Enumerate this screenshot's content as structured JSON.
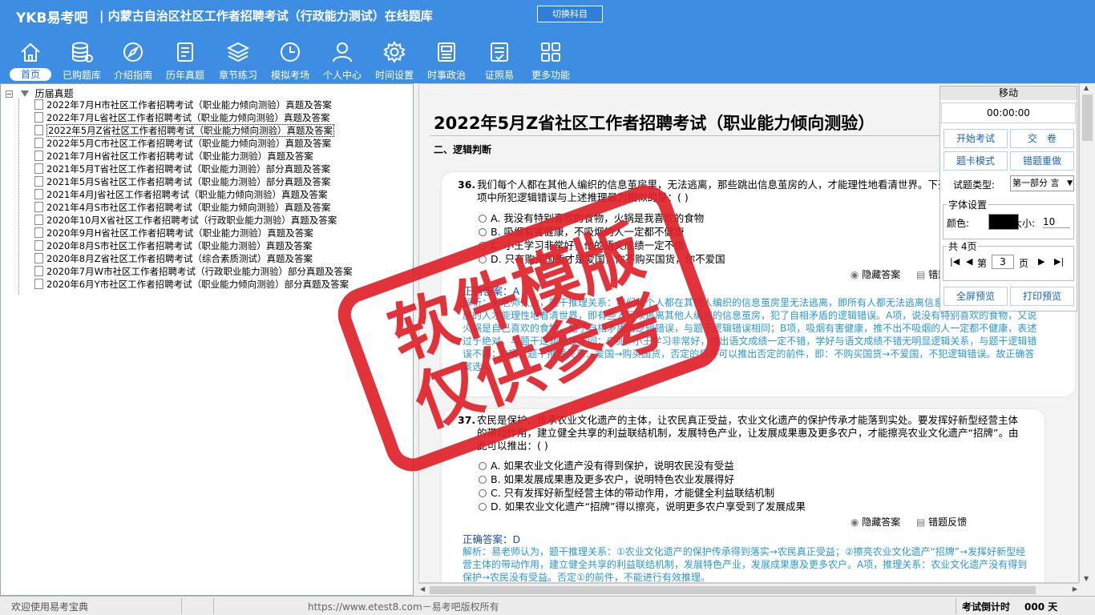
{
  "app": {
    "logo": "YKB易考吧",
    "title": "内蒙古自治区社区工作者招聘考试（行政能力测试）在线题库",
    "switch_label": "切换科目"
  },
  "nav": [
    {
      "label": "首页",
      "icon": "home-icon"
    },
    {
      "label": "已购题库",
      "icon": "database-icon"
    },
    {
      "label": "介绍指南",
      "icon": "compass-icon"
    },
    {
      "label": "历年真题",
      "icon": "document-icon"
    },
    {
      "label": "章节练习",
      "icon": "layers-icon"
    },
    {
      "label": "模拟考场",
      "icon": "clock-icon"
    },
    {
      "label": "个人中心",
      "icon": "user-icon"
    },
    {
      "label": "时间设置",
      "icon": "gear-icon"
    },
    {
      "label": "时事政治",
      "icon": "newspaper-icon"
    },
    {
      "label": "证照易",
      "icon": "checklist-icon"
    },
    {
      "label": "更多功能",
      "icon": "grid-icon"
    }
  ],
  "tree": {
    "root": "历届真题",
    "items": [
      "2022年7月H市社区工作者招聘考试（职业能力倾向测验）真题及答案",
      "2022年7月L省社区工作者招聘考试（职业能力倾向测验）真题及答案",
      "2022年5月Z省社区工作者招聘考试（职业能力倾向测验）真题及答案",
      "2022年5月C市社区工作者招聘考试（职业能力倾向测验）真题及答案",
      "2021年7月H省社区工作者招聘考试（职业能力测验）真题及答案",
      "2021年5月T省社区工作者招聘考试（职业能力测验）部分真题及答案",
      "2021年5月S省社区工作者招聘考试（职业能力测验）部分真题及答案",
      "2021年4月J省社区工作者招聘考试（职业能力倾向测验）真题及答案",
      "2021年4月S市社区工作者招聘考试（职业能力倾向测验）真题及答案",
      "2020年10月X省社区工作者招聘考试（行政职业能力测验）真题及答案",
      "2020年9月H省社区工作者招聘考试（职业能力测验）真题及答案",
      "2020年8月S市社区工作者招聘考试（职业能力测验）真题及答案",
      "2020年8月Z省社区工作者招聘考试（综合素质测试）真题及答案",
      "2020年7月W市社区工作者招聘考试（行政职业能力测验）部分真题及答案",
      "2020年6月Y市社区工作者招聘考试（职业能力倾向测验）部分真题及答案"
    ],
    "selected_index": 2
  },
  "content": {
    "doc_title": "2022年5月Z省社区工作者招聘考试（职业能力倾向测验）真题及答案",
    "section": "二、逻辑判断",
    "q36": {
      "number": "36.",
      "text": "我们每个人都在其他人编织的信息茧房里，无法逃离，那些跳出信息茧房的人，才能理性地看清世界。下列选项中所犯逻辑错误与上述推理最为相似的是：( )",
      "options": [
        "A. 我没有特别喜欢的食物，火锅是我喜欢的食物",
        "B. 吸烟有害健康，不吸烟的人一定都不健康",
        "C. 小王学习非常好，他的语文成绩一定不错",
        "D. 只有购买国货才是爱国，你不购买国货，你不爱国"
      ],
      "hide_answer": "隐藏答案",
      "feedback": "错题反馈",
      "correct_label": "正确答案：A",
      "explanation": "解析：易老师认为，题干推理关系：我们每个人都在其他人编织的信息茧房里无法逃离，即所有人都无法逃离信息茧房，又说跳出信息茧房的人才能理性地看清世界，即有些人可以逃离其他人编织的信息茧房，犯了自相矛盾的逻辑错误。A项，说没有特别喜欢的食物，又说火锅是自己喜欢的食物，犯了自相矛盾的逻辑错误，与题干逻辑错误相同；B项，吸烟有害健康，推不出不吸烟的人一定都不健康，表述过于绝对，与题干逻辑错误不同；C项，小王学习非常好，推出语文成绩一定不错，学好与语文成绩不错无明显逻辑关系，与题干逻辑错误不同；D项，题干推理关系：爱国→购买国货，否定的后件可以推出否定的前件，即：不购买国货→不爱国，不犯逻辑错误。故正确答案选A。"
    },
    "q37": {
      "number": "37.",
      "text": "农民是保护、传承农业文化遗产的主体，让农民真正受益，农业文化遗产的保护传承才能落到实处。要发挥好新型经营主体的带动作用，建立健全共享的利益联结机制，发展特色产业，让发展成果惠及更多农户，才能擦亮农业文化遗产“招牌”。由此可以推出：( )",
      "options": [
        "A. 如果农业文化遗产没有得到保护，说明农民没有受益",
        "B. 如果发展成果惠及更多农户，说明特色农业发展得好",
        "C. 只有发挥好新型经营主体的带动作用，才能健全利益联结机制",
        "D. 如果农业文化遗产“招牌”得以擦亮，说明更多农户享受到了发展成果"
      ],
      "hide_answer": "隐藏答案",
      "feedback": "错题反馈",
      "correct_label": "正确答案：D",
      "explanation": "解析：易老师认为，题干推理关系：①农业文化遗产的保护传承得到落实→农民真正受益；②擦亮农业文化遗产“招牌”→发挥好新型经营主体的带动作用，建立健全共享的利益联结机制，发展特色产业，发展成果惠及更多农户。A项，推理关系：农业文化遗产没有得到保护→农民没有受益。否定①的前件，不能进行有效推理。"
    }
  },
  "panel": {
    "move_label": "移动",
    "timer": "00:00:00",
    "start_exam": "开始考试",
    "submit": "交　卷",
    "card_mode": "题卡模式",
    "redo_wrong": "错题重做",
    "qtype_label": "试题类型:",
    "qtype_value": "第一部分 言",
    "font_settings": "字体设置",
    "color_label": "颜色:",
    "font_color": "#000000",
    "size_label": "大小:",
    "size_value": "10",
    "pages_label": "共 4页",
    "page_prefix": "第",
    "page_value": "3",
    "page_suffix": "页",
    "fullscreen": "全屏预览",
    "print_preview": "打印预览"
  },
  "status": {
    "welcome": "欢迎使用易考宝典",
    "url": "https://www.etest8.com－易考吧版权所有",
    "countdown_label": "考试倒计时",
    "countdown_value": "000 天"
  },
  "watermark": {
    "line1": "软件模版",
    "line2": "仅供参考"
  },
  "colors": {
    "topbar": "#3d8ee2",
    "stamp": "#e0212a",
    "explanation": "#2a98d6"
  }
}
